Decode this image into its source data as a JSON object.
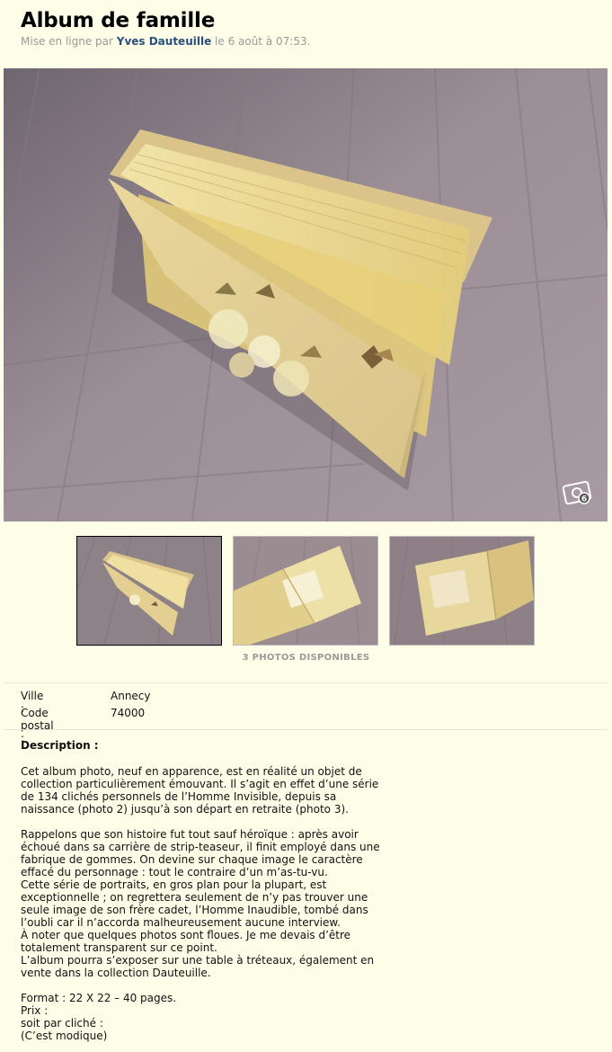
{
  "listing": {
    "title": "Album de famille",
    "byline_prefix": "Mise en ligne par ",
    "author": "Yves Dauteuille",
    "byline_suffix": " le 6 août à 07:53."
  },
  "gallery": {
    "photo_count_label": "3 PHOTOS DISPONIBLES",
    "thumbnails": [
      {
        "subject": "closed-album",
        "selected": true
      },
      {
        "subject": "open-album-left",
        "selected": false
      },
      {
        "subject": "open-album-right",
        "selected": false
      }
    ],
    "camera_icon": "camera-icon"
  },
  "details": {
    "city_label": "Ville :",
    "city": "Annecy",
    "postal_label": "Code postal :",
    "postal": "74000"
  },
  "description": {
    "title": "Description :",
    "text": "Cet album photo, neuf en apparence, est en réalité un objet de\ncollection particulièrement émouvant. Il s’agit en effet d’une série\nde 134 clichés personnels de l’Homme Invisible, depuis sa\nnaissance (photo 2) jusqu’à son départ en retraite (photo 3).\n\nRappelons que son histoire fut tout sauf héroïque : après avoir\néchoué dans sa carrière de strip-teaseur, il finit employé dans une\nfabrique de gommes. On devine sur chaque image le caractère\neffacé du personnage : tout le contraire d’un m’as-tu-vu.\nCette série de portraits, en gros plan pour la plupart, est\nexceptionnelle ; on regrettera seulement de n’y pas trouver une\nseule image de son frère cadet, l’Homme Inaudible, tombé dans\nl’oubli car il n’accorda malheureusement aucune interview.\nÀ noter que quelques photos sont floues. Je me devais d’être\ntotalement transparent sur ce point.\nL’album pourra s’exposer sur une table à tréteaux, également en\nvente dans la collection Dauteuille.\n\nFormat : 22 X 22 – 40 pages.\nPrix :\nsoit par cliché :\n(C’est modique)"
  },
  "colors": {
    "background": "#fefee8",
    "author_link": "#2b4f7d",
    "muted": "#999999"
  }
}
